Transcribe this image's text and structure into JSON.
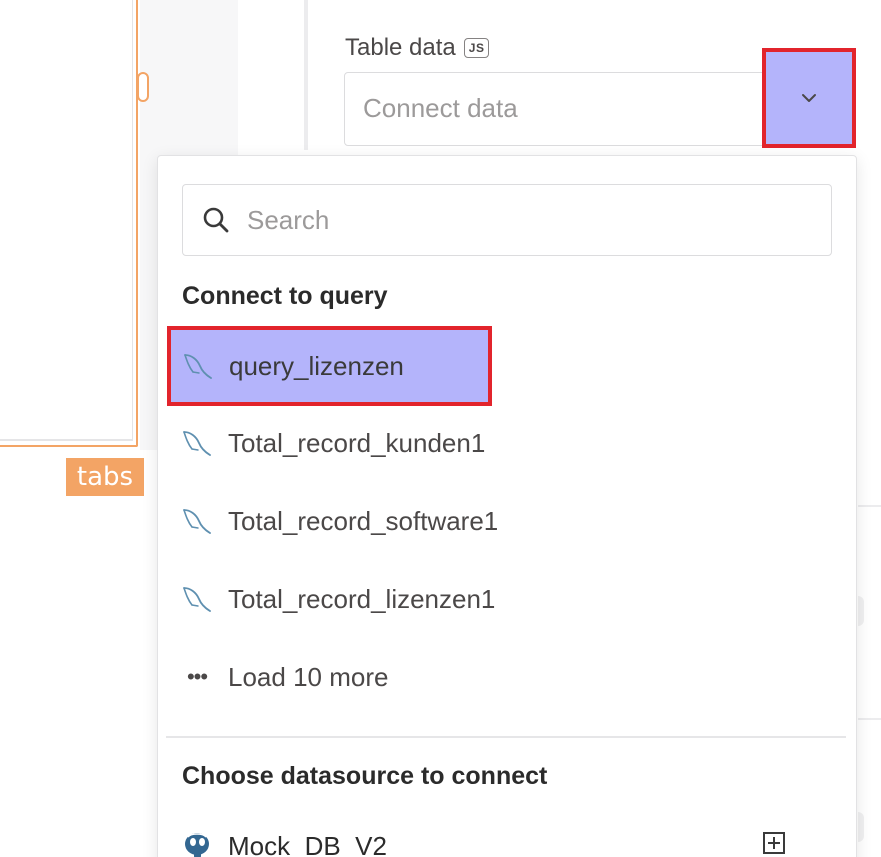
{
  "canvas": {
    "widget_label": "tabs"
  },
  "property": {
    "label": "Table data",
    "badge": "JS",
    "placeholder": "Connect data"
  },
  "dropdown": {
    "search_placeholder": "Search",
    "section_queries": "Connect to query",
    "queries": [
      {
        "label": "query_lizenzen",
        "icon": "mysql-icon",
        "selected": true
      },
      {
        "label": "Total_record_kunden1",
        "icon": "mysql-icon",
        "selected": false
      },
      {
        "label": "Total_record_software1",
        "icon": "mysql-icon",
        "selected": false
      },
      {
        "label": "Total_record_lizenzen1",
        "icon": "mysql-icon",
        "selected": false
      }
    ],
    "load_more": "Load 10 more",
    "section_datasources": "Choose datasource to connect",
    "datasources": [
      {
        "label": "Mock_DB_V2",
        "icon": "postgres-icon"
      }
    ]
  },
  "colors": {
    "highlight": "#b4b4fb",
    "outline": "#e2242c",
    "widget_accent": "#f3a465"
  }
}
